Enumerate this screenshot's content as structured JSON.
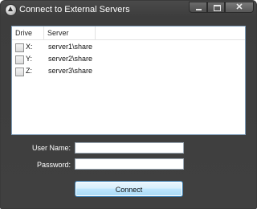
{
  "window": {
    "title": "Connect to External Servers"
  },
  "title_controls": {
    "minimize": "minimize-icon",
    "maximize": "maximize-icon",
    "close_glyph": "✕"
  },
  "table": {
    "columns": [
      "Drive",
      "Server"
    ],
    "rows": [
      {
        "drive": "X:",
        "server": "server1\\share",
        "checked": false
      },
      {
        "drive": "Y:",
        "server": "server2\\share",
        "checked": false
      },
      {
        "drive": "Z:",
        "server": "server3\\share",
        "checked": false
      }
    ]
  },
  "form": {
    "username_label": "User Name:",
    "username_value": "",
    "password_label": "Password:",
    "password_value": ""
  },
  "connect_label": "Connect"
}
